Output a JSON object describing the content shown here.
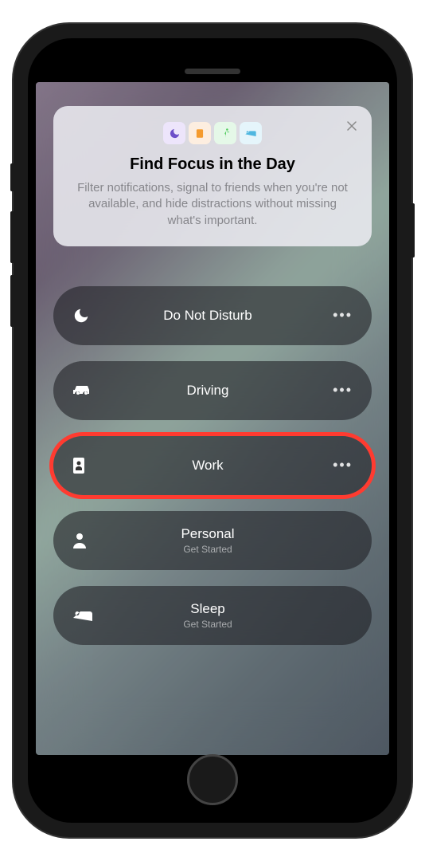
{
  "info_card": {
    "title": "Find Focus in the Day",
    "description": "Filter notifications, signal to friends when you're not available, and hide distractions without missing what's important.",
    "icons": [
      "moon",
      "book",
      "runner",
      "bed"
    ]
  },
  "focus_modes": [
    {
      "icon": "moon",
      "label": "Do Not Disturb",
      "subtitle": "",
      "has_more": true,
      "highlighted": false
    },
    {
      "icon": "car",
      "label": "Driving",
      "subtitle": "",
      "has_more": true,
      "highlighted": false
    },
    {
      "icon": "badge",
      "label": "Work",
      "subtitle": "",
      "has_more": true,
      "highlighted": true
    },
    {
      "icon": "person",
      "label": "Personal",
      "subtitle": "Get Started",
      "has_more": false,
      "highlighted": false
    },
    {
      "icon": "bed",
      "label": "Sleep",
      "subtitle": "Get Started",
      "has_more": false,
      "highlighted": false
    }
  ],
  "more_glyph": "•••"
}
